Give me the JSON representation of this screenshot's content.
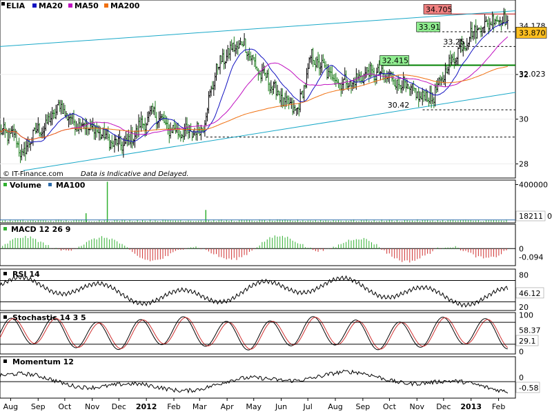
{
  "chart_data": [
    {
      "type": "line",
      "panel": "price",
      "symbol": "ELIA",
      "series": [
        {
          "name": "MA20",
          "color": "#1010c0"
        },
        {
          "name": "MA50",
          "color": "#c010c0"
        },
        {
          "name": "MA200",
          "color": "#f07010"
        }
      ],
      "watermark": "© IT-Finance.com",
      "disclaimer": "Data is Indicative and Delayed.",
      "ylim": [
        27.4,
        35.3
      ],
      "yticks": [
        28,
        30,
        32
      ],
      "price_labels": {
        "last": "33.870",
        "alt": "34.178",
        "ma200": "32.023"
      },
      "annotations": [
        "34.705",
        "33.91",
        "33.25",
        "32.415",
        "30.42"
      ],
      "levels": [
        34.705,
        33.91,
        33.25,
        32.415,
        30.42,
        29.2
      ],
      "trendlines": [
        {
          "from": [
            "2011-07-20",
            33.25
          ],
          "to": [
            "2013-02-20",
            34.85
          ]
        },
        {
          "from": [
            "2011-08-15",
            27.7
          ],
          "to": [
            "2013-02-20",
            31.2
          ]
        }
      ],
      "price": {
        "dates": [
          "2011-07-20",
          "2011-08-05",
          "2011-08-15",
          "2011-08-25",
          "2011-09-10",
          "2011-09-25",
          "2011-10-10",
          "2011-10-25",
          "2011-11-10",
          "2011-11-25",
          "2011-12-10",
          "2011-12-25",
          "2012-01-10",
          "2012-01-25",
          "2012-02-10",
          "2012-02-25",
          "2012-03-05",
          "2012-03-20",
          "2012-04-05",
          "2012-04-20",
          "2012-05-05",
          "2012-05-20",
          "2012-06-05",
          "2012-06-20",
          "2012-07-05",
          "2012-07-20",
          "2012-08-05",
          "2012-08-20",
          "2012-09-05",
          "2012-09-20",
          "2012-10-05",
          "2012-10-20",
          "2012-11-05",
          "2012-11-20",
          "2012-12-05",
          "2012-12-20",
          "2013-01-05",
          "2013-01-20",
          "2013-02-05",
          "2013-02-15"
        ],
        "close": [
          29.4,
          29.3,
          28.3,
          29.3,
          29.7,
          30.6,
          29.9,
          29.7,
          29.4,
          28.9,
          28.9,
          29.7,
          30.3,
          29.6,
          29.4,
          29.4,
          29.7,
          32.3,
          33.1,
          33.4,
          32.2,
          31.6,
          30.7,
          30.4,
          32.8,
          32.2,
          31.7,
          31.6,
          32.1,
          32.0,
          31.8,
          31.4,
          31.0,
          31.0,
          32.3,
          33.2,
          33.95,
          34.3,
          34.6,
          33.87
        ]
      }
    },
    {
      "type": "bar",
      "panel": "volume",
      "series": [
        {
          "name": "Volume",
          "color": "#30b030"
        },
        {
          "name": "MA100",
          "color": "#2a6aa8"
        }
      ],
      "ylim": [
        0,
        440000
      ],
      "yticks": [
        400000
      ],
      "last_label": "18211",
      "extra_label": "0",
      "spikes": [
        {
          "date": "2011-11-18",
          "value": 430000
        },
        {
          "date": "2012-03-08",
          "value": 130000
        },
        {
          "date": "2011-10-25",
          "value": 95000
        }
      ]
    },
    {
      "type": "bar",
      "panel": "macd",
      "series": [
        {
          "name": "MACD 12 26 9"
        }
      ],
      "ylim": [
        -0.9,
        1.3
      ],
      "yticks": [
        0
      ],
      "last_label": "-0.094",
      "pos_color": "#30b030",
      "neg_color": "#d03030"
    },
    {
      "type": "line",
      "panel": "rsi",
      "series": [
        {
          "name": "RSI 14"
        }
      ],
      "ylim": [
        15,
        90
      ],
      "yticks": [
        80,
        20
      ],
      "levels": [
        70,
        30
      ],
      "last_label": "46.12"
    },
    {
      "type": "line",
      "panel": "stochastic",
      "series": [
        {
          "name": "Stochastic 14 3 5"
        }
      ],
      "ylim": [
        -5,
        105
      ],
      "yticks": [
        100,
        0
      ],
      "levels": [
        80,
        20
      ],
      "last_label": "58.37",
      "last_label2": "29.1",
      "signal_color": "#d03030"
    },
    {
      "type": "line",
      "panel": "momentum",
      "series": [
        {
          "name": "Momentum 12"
        }
      ],
      "ylim": [
        -1.5,
        2.3
      ],
      "yticks": [
        0
      ],
      "last_label": "-0.58"
    }
  ],
  "x_axis": {
    "start": "2011-07-20",
    "end": "2013-02-20",
    "ticks": [
      {
        "date": "2011-08-01",
        "label": "Aug",
        "bold": false
      },
      {
        "date": "2011-09-01",
        "label": "Sep",
        "bold": false
      },
      {
        "date": "2011-10-01",
        "label": "Oct",
        "bold": false
      },
      {
        "date": "2011-11-01",
        "label": "Nov",
        "bold": false
      },
      {
        "date": "2011-12-01",
        "label": "Dec",
        "bold": false
      },
      {
        "date": "2012-01-01",
        "label": "2012",
        "bold": true
      },
      {
        "date": "2012-02-01",
        "label": "Feb",
        "bold": false
      },
      {
        "date": "2012-03-01",
        "label": "Mar",
        "bold": false
      },
      {
        "date": "2012-04-01",
        "label": "Apr",
        "bold": false
      },
      {
        "date": "2012-05-01",
        "label": "May",
        "bold": false
      },
      {
        "date": "2012-06-01",
        "label": "Jun",
        "bold": false
      },
      {
        "date": "2012-07-01",
        "label": "Jul",
        "bold": false
      },
      {
        "date": "2012-08-01",
        "label": "Aug",
        "bold": false
      },
      {
        "date": "2012-09-01",
        "label": "Sep",
        "bold": false
      },
      {
        "date": "2012-10-01",
        "label": "Oct",
        "bold": false
      },
      {
        "date": "2012-11-01",
        "label": "Nov",
        "bold": false
      },
      {
        "date": "2012-12-01",
        "label": "Dec",
        "bold": false
      },
      {
        "date": "2013-01-01",
        "label": "2013",
        "bold": true
      },
      {
        "date": "2013-02-01",
        "label": "Feb",
        "bold": false
      }
    ]
  },
  "colors": {
    "price_up": "#000000",
    "price_down": "#1a7a1a",
    "trend": "#18a8c8",
    "resistance_fill": "#f08080",
    "support_fill": "#90ee90",
    "last_fill": "#ffc020"
  }
}
